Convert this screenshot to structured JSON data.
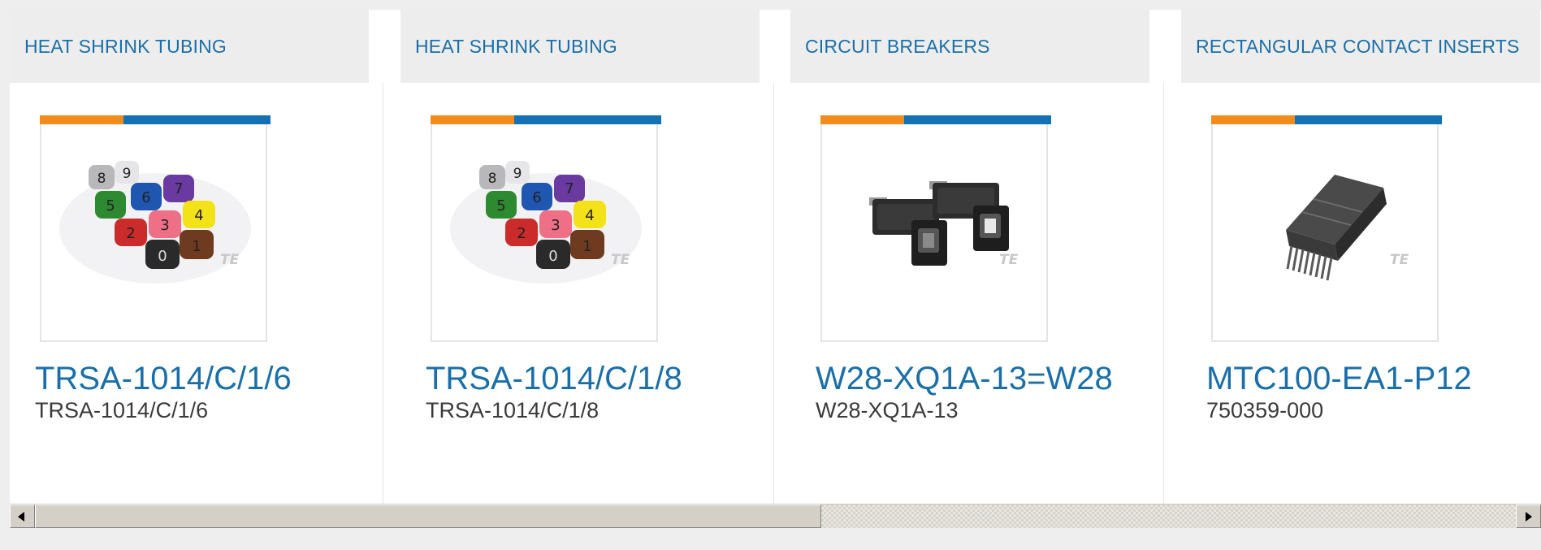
{
  "cards": [
    {
      "category": "HEAT SHRINK TUBING",
      "part_number": "TRSA-1014/C/1/6",
      "sub": "TRSA-1014/C/1/6",
      "image": "heat-shrink-markers-image",
      "watermark": "TE"
    },
    {
      "category": "HEAT SHRINK TUBING",
      "part_number": "TRSA-1014/C/1/8",
      "sub": "TRSA-1014/C/1/8",
      "image": "heat-shrink-markers-image",
      "watermark": "TE"
    },
    {
      "category": "CIRCUIT BREAKERS",
      "part_number": "W28-XQ1A-13=W28",
      "sub": "W28-XQ1A-13",
      "image": "circuit-breakers-image",
      "watermark": "TE"
    },
    {
      "category": "RECTANGULAR CONTACT INSERTS",
      "part_number": "MTC100-EA1-P12",
      "sub": "750359-000",
      "image": "contact-insert-image",
      "watermark": "TE"
    }
  ],
  "colors": {
    "accent_blue": "#1a6fa8",
    "bar_orange": "#f28c1d",
    "bar_blue": "#1471b3",
    "header_bg": "#ededed"
  },
  "scrollbar": {
    "left_icon": "arrow-left-icon",
    "right_icon": "arrow-right-icon"
  }
}
